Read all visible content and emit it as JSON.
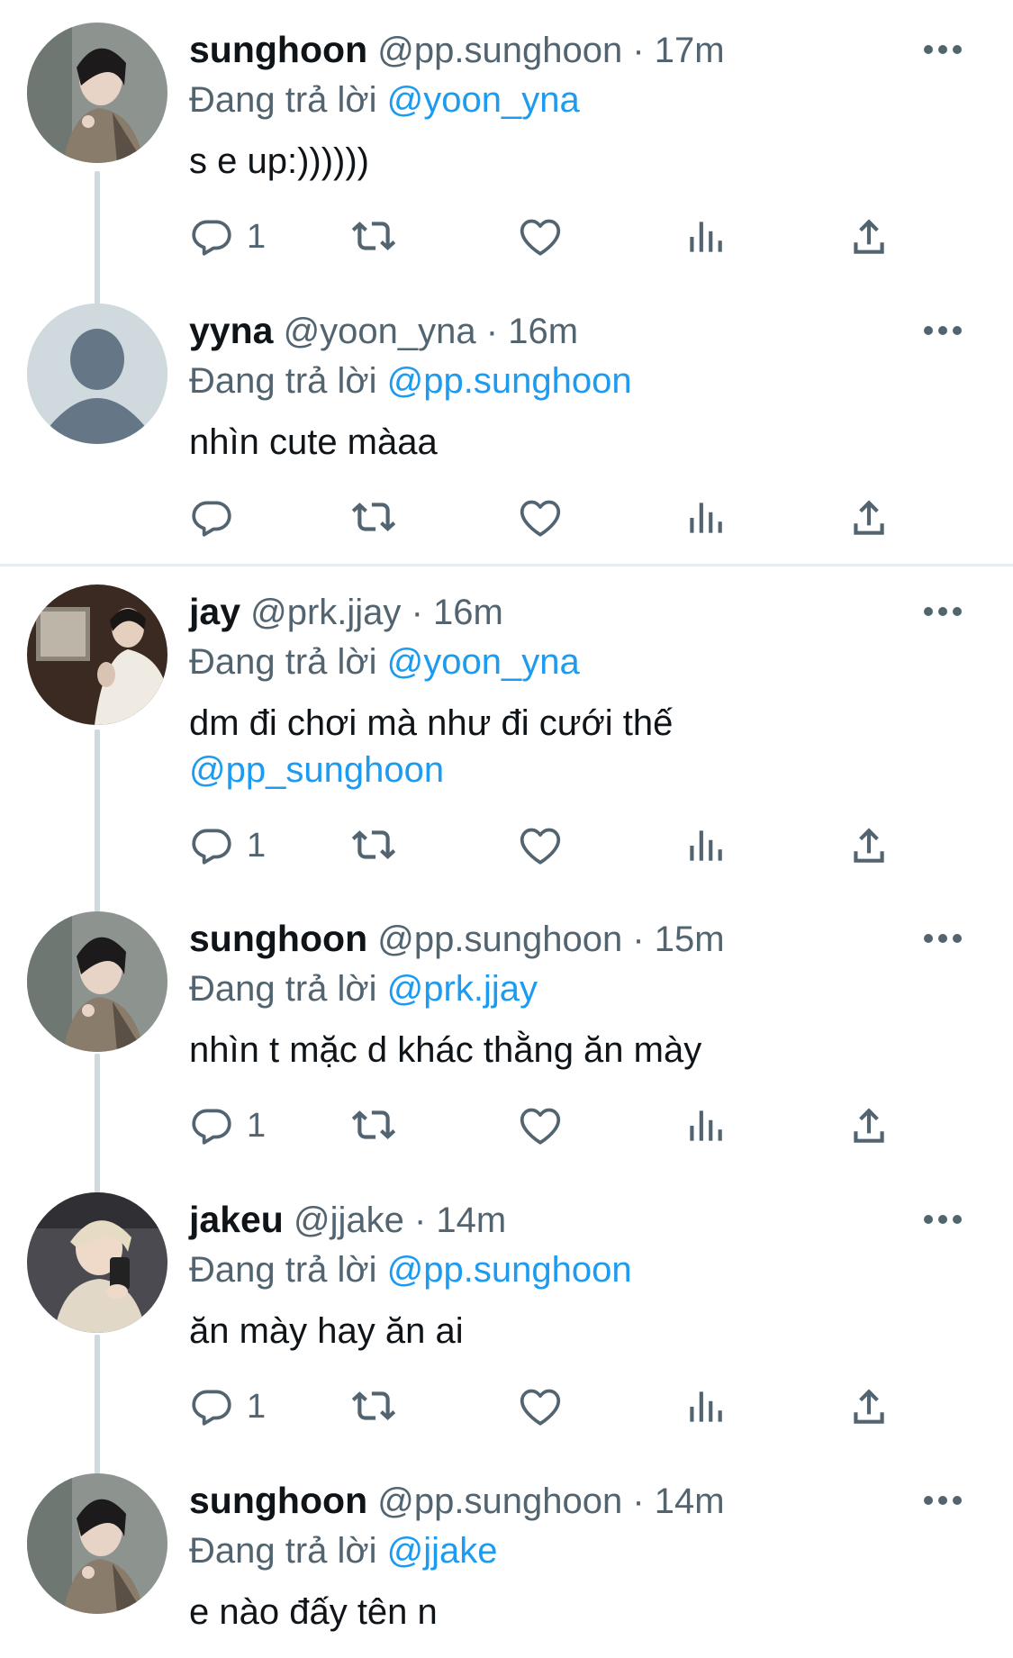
{
  "reply_prefix": "Đang trả lời",
  "tweets": [
    {
      "name": "sunghoon",
      "handle": "@pp.sunghoon",
      "time": "· 17m",
      "reply_to": "@yoon_yna",
      "text": "s e up:))))))",
      "mention_text": "",
      "reply_count": "1",
      "avatar": "photo-dark-hair"
    },
    {
      "name": "yyna",
      "handle": "@yoon_yna",
      "time": "· 16m",
      "reply_to": "@pp.sunghoon",
      "text": "nhìn cute màaa",
      "mention_text": "",
      "reply_count": "",
      "avatar": "default-avatar"
    },
    {
      "name": "jay",
      "handle": "@prk.jjay",
      "time": "· 16m",
      "reply_to": "@yoon_yna",
      "text": "dm đi chơi mà như đi cưới thế",
      "mention_text": "@pp_sunghoon",
      "reply_count": "1",
      "avatar": "photo-white-suit"
    },
    {
      "name": "sunghoon",
      "handle": "@pp.sunghoon",
      "time": "· 15m",
      "reply_to": "@prk.jjay",
      "text": "nhìn t mặc d khác thằng ăn mày",
      "mention_text": "",
      "reply_count": "1",
      "avatar": "photo-dark-hair"
    },
    {
      "name": "jakeu",
      "handle": "@jjake",
      "time": "· 14m",
      "reply_to": "@pp.sunghoon",
      "text": "ăn mày hay ăn ai",
      "mention_text": "",
      "reply_count": "1",
      "avatar": "photo-blond-hair"
    },
    {
      "name": "sunghoon",
      "handle": "@pp.sunghoon",
      "time": "· 14m",
      "reply_to": "@jjake",
      "text": "e nào đấy tên n",
      "mention_text": "",
      "reply_count": "",
      "avatar": "photo-dark-hair"
    }
  ],
  "icons": {
    "reply": "reply-icon",
    "retweet": "retweet-icon",
    "like": "heart-icon",
    "views": "analytics-icon",
    "share": "share-icon",
    "more": "more-icon"
  },
  "colors": {
    "link": "#1d9bf0",
    "secondary": "#536471",
    "thread_line": "#cfd9de",
    "text": "#0f1419"
  }
}
